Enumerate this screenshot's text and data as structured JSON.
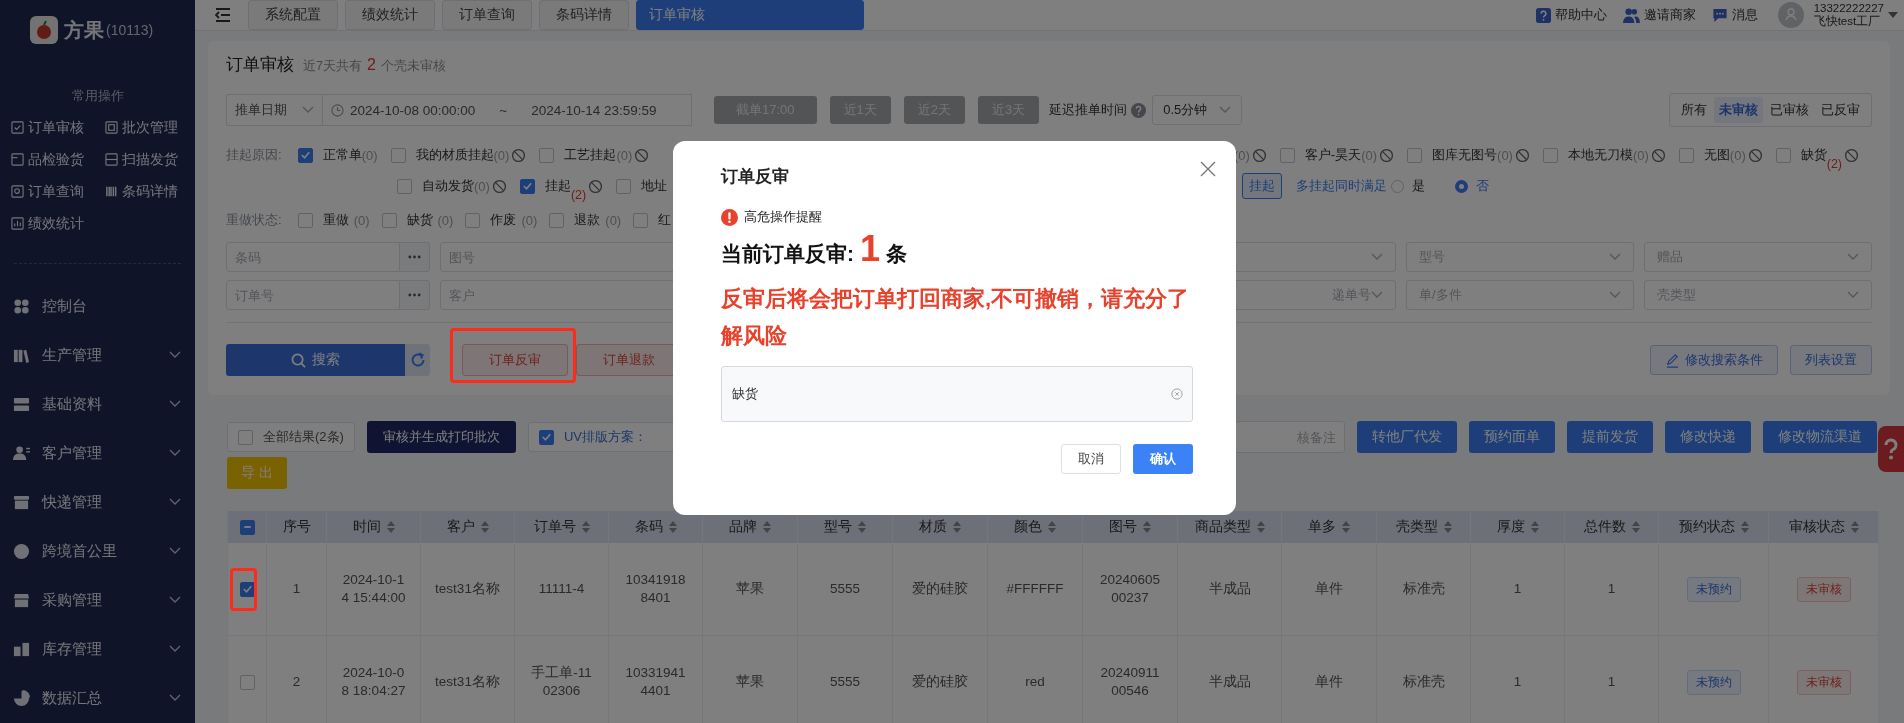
{
  "sidebar": {
    "brand": "方果",
    "brand_code": "(10113)",
    "quick_title": "常用操作",
    "quick_links": [
      {
        "label": "订单审核"
      },
      {
        "label": "批次管理"
      },
      {
        "label": "品检验货"
      },
      {
        "label": "扫描发货"
      },
      {
        "label": "订单查询"
      },
      {
        "label": "条码详情"
      },
      {
        "label": "绩效统计"
      }
    ],
    "menu": [
      {
        "label": "控制台",
        "expandable": false
      },
      {
        "label": "生产管理",
        "expandable": true
      },
      {
        "label": "基础资料",
        "expandable": true
      },
      {
        "label": "客户管理",
        "expandable": true
      },
      {
        "label": "快递管理",
        "expandable": true
      },
      {
        "label": "跨境首公里",
        "expandable": true
      },
      {
        "label": "采购管理",
        "expandable": true
      },
      {
        "label": "库存管理",
        "expandable": true
      },
      {
        "label": "数据汇总",
        "expandable": true
      }
    ]
  },
  "topbar": {
    "tabs": [
      {
        "label": "系统配置",
        "selected": false
      },
      {
        "label": "绩效统计",
        "selected": false
      },
      {
        "label": "订单查询",
        "selected": false
      },
      {
        "label": "条码详情",
        "selected": false
      },
      {
        "label": "订单审核",
        "selected": true
      }
    ],
    "help": "帮助中心",
    "invite": "邀请商家",
    "messages": "消息",
    "user_phone": "13322222227",
    "user_name": "飞快test工厂"
  },
  "page": {
    "title": "订单审核",
    "summary_prefix": "近7天共有",
    "summary_count": "2",
    "summary_suffix": "个壳未审核"
  },
  "date_filter": {
    "field": "推单日期",
    "start": "2024-10-08 00:00:00",
    "separator": "~",
    "end": "2024-10-14 23:59:59",
    "quick": [
      "截单17:00",
      "近1天",
      "近2天",
      "近3天"
    ],
    "delay_label": "延迟推单时间",
    "delay_value": "0.5分钟"
  },
  "review_tabs": [
    {
      "label": "所有",
      "selected": false
    },
    {
      "label": "未审核",
      "selected": true
    },
    {
      "label": "已审核",
      "selected": false
    },
    {
      "label": "已反审",
      "selected": false
    }
  ],
  "hold_filter": {
    "label": "挂起原因:",
    "row1_left": [
      {
        "kind": "full",
        "text": "正常单",
        "count": "(0)",
        "alert": false,
        "checked": true,
        "excludable": false
      },
      {
        "kind": "full",
        "text": "我的材质挂起",
        "count": "(0)",
        "alert": false,
        "checked": false,
        "excludable": true
      },
      {
        "kind": "full",
        "text": "工艺挂起",
        "count": "(0)",
        "alert": false,
        "checked": false,
        "excludable": true
      }
    ],
    "row1_right": [
      {
        "kind": "count_only",
        "count": "(0)",
        "alert": false,
        "excludable": true
      },
      {
        "kind": "full",
        "text": "客户-昊天",
        "count": "(0)",
        "alert": false,
        "checked": false,
        "excludable": true
      },
      {
        "kind": "full",
        "text": "图库无图号",
        "count": "(0)",
        "alert": false,
        "checked": false,
        "excludable": true
      },
      {
        "kind": "full",
        "text": "本地无刀模",
        "count": "(0)",
        "alert": false,
        "checked": false,
        "excludable": true
      },
      {
        "kind": "full",
        "text": "无图",
        "count": "(0)",
        "alert": false,
        "checked": false,
        "excludable": true
      },
      {
        "kind": "full",
        "text": "缺货",
        "count": "(2)",
        "alert": true,
        "checked": false,
        "excludable": true
      }
    ],
    "row2_left": [
      {
        "kind": "full",
        "text": "自动发货",
        "count": "(0)",
        "alert": false,
        "checked": false,
        "excludable": true
      },
      {
        "kind": "full",
        "text": "挂起",
        "count": "(2)",
        "alert": true,
        "checked": true,
        "excludable": true
      },
      {
        "kind": "label_only",
        "text": "地址",
        "checked": false
      }
    ],
    "new_hold_button": "挂起",
    "multi_label": "多挂起同时满足",
    "radios": [
      {
        "label": "是",
        "selected": false
      },
      {
        "label": "否",
        "selected": true
      }
    ]
  },
  "redo_filter": {
    "label": "重做状态:",
    "items": [
      {
        "kind": "full",
        "text": "重做",
        "count": "(0)",
        "checked": false
      },
      {
        "kind": "full",
        "text": "缺货",
        "count": "(0)",
        "checked": false
      },
      {
        "kind": "full",
        "text": "作废",
        "count": "(0)",
        "checked": false
      },
      {
        "kind": "full",
        "text": "退款",
        "count": "(0)",
        "checked": false
      },
      {
        "kind": "label_only",
        "text": "红",
        "checked": false
      }
    ]
  },
  "search_fields": {
    "left": [
      [
        {
          "placeholder": "条码",
          "more": true
        },
        {
          "placeholder": "图号",
          "more": false
        }
      ],
      [
        {
          "placeholder": "订单号",
          "more": true
        },
        {
          "placeholder": "客户",
          "more": false
        }
      ]
    ],
    "right": [
      [
        {
          "kind": "select"
        },
        {
          "kind": "select",
          "placeholder": "型号"
        },
        {
          "kind": "select",
          "placeholder": "赠品"
        }
      ],
      [
        {
          "kind": "select",
          "placeholder": "递单号"
        },
        {
          "kind": "select",
          "placeholder": "单/多件"
        },
        {
          "kind": "select",
          "placeholder": "壳类型"
        }
      ]
    ]
  },
  "actions": {
    "search": "搜索",
    "buttons": [
      {
        "label": "订单反审",
        "highlighted": true
      },
      {
        "label": "订单退款",
        "highlighted": false
      }
    ],
    "edit_conditions": "修改搜索条件",
    "list_settings": "列表设置"
  },
  "toolbar": {
    "all_results": {
      "label": "全部结果(2条)",
      "checked": false
    },
    "review_batch": "审核并生成打印批次",
    "uv": {
      "label": "UV排版方案：",
      "checked": true
    },
    "remark_placeholder": "核备注",
    "buttons": [
      "转他厂代发",
      "预约面单",
      "提前发货",
      "修改快递",
      "修改物流渠道"
    ],
    "export": "导 出"
  },
  "table": {
    "header_check": {
      "indeterminate": true
    },
    "columns": [
      {
        "label": "序号",
        "sortable": false,
        "kind": "text"
      },
      {
        "label": "时间",
        "sortable": true,
        "kind": "text"
      },
      {
        "label": "客户",
        "sortable": true,
        "kind": "text"
      },
      {
        "label": "订单号",
        "sortable": true,
        "kind": "text"
      },
      {
        "label": "条码",
        "sortable": true,
        "kind": "text"
      },
      {
        "label": "品牌",
        "sortable": true,
        "kind": "text"
      },
      {
        "label": "型号",
        "sortable": true,
        "kind": "text"
      },
      {
        "label": "材质",
        "sortable": true,
        "kind": "text"
      },
      {
        "label": "颜色",
        "sortable": true,
        "kind": "text"
      },
      {
        "label": "图号",
        "sortable": true,
        "kind": "text"
      },
      {
        "label": "商品类型",
        "sortable": true,
        "kind": "text"
      },
      {
        "label": "单多",
        "sortable": true,
        "kind": "text"
      },
      {
        "label": "壳类型",
        "sortable": true,
        "kind": "text"
      },
      {
        "label": "厚度",
        "sortable": true,
        "kind": "text"
      },
      {
        "label": "总件数",
        "sortable": true,
        "kind": "text"
      },
      {
        "label": "预约状态",
        "sortable": true,
        "kind": "tag_info"
      },
      {
        "label": "审核状态",
        "sortable": true,
        "kind": "tag_danger"
      }
    ],
    "rows": [
      {
        "selected": true,
        "highlighted": true,
        "cells": [
          "1",
          "2024-10-14 15:44:00",
          "test31名称",
          "11111-4",
          "103419188401",
          "苹果",
          "5555",
          "爱的硅胶",
          "#FFFFFF",
          "2024060500237",
          "半成品",
          "单件",
          "标准壳",
          "1",
          "1",
          "未预约",
          "未审核"
        ]
      },
      {
        "selected": false,
        "highlighted": false,
        "cells": [
          "2",
          "2024-10-08 18:04:27",
          "test31名称",
          "手工单-1102306",
          "103319414401",
          "苹果",
          "5555",
          "爱的硅胶",
          "red",
          "2024091100546",
          "半成品",
          "单件",
          "标准壳",
          "1",
          "1",
          "未预约",
          "未审核"
        ]
      }
    ]
  },
  "dialog": {
    "title": "订单反审",
    "alert": "高危操作提醒",
    "count_label": "当前订单反审:",
    "count": "1",
    "count_unit": "条",
    "warning": "反审后将会把订单打回商家,不可撤销，请充分了解风险",
    "reason": {
      "value": "缺货"
    },
    "cancel": "取消",
    "confirm": "确认"
  }
}
